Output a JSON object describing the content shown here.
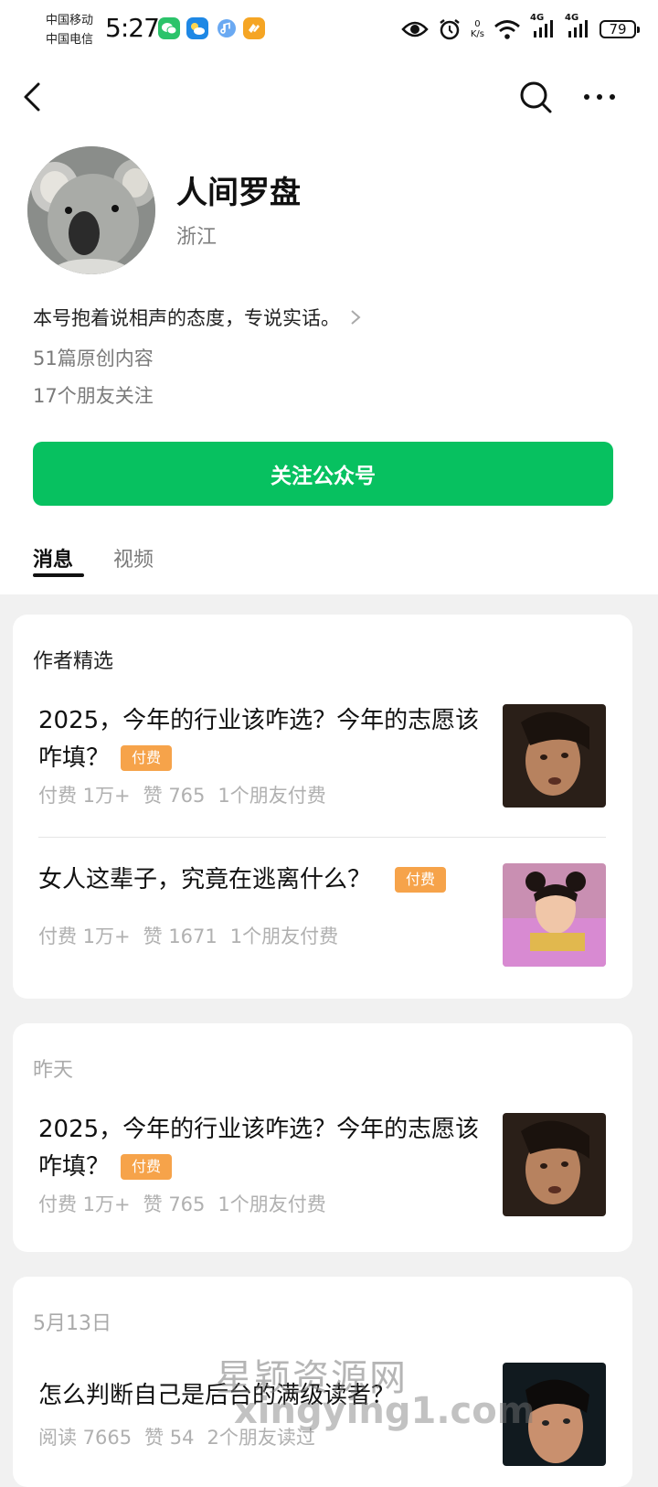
{
  "status_bar": {
    "carrier1": "中国移动",
    "carrier2": "中国电信",
    "time": "5:27",
    "net_speed_value": "0",
    "net_speed_unit": "K/s",
    "signal1": "4G",
    "signal2": "4G",
    "battery": "79"
  },
  "profile": {
    "name": "人间罗盘",
    "region": "浙江",
    "description": "本号抱着说相声的态度，专说实话。",
    "original_count": "51篇原创内容",
    "friends_following": "17个朋友关注",
    "follow_button": "关注公众号"
  },
  "tabs": [
    {
      "label": "消息",
      "active": true
    },
    {
      "label": "视频",
      "active": false
    }
  ],
  "featured": {
    "title": "作者精选",
    "articles": [
      {
        "title": "2025，今年的行业该咋选？今年的志愿该咋填？",
        "badge": "付费",
        "paid": "付费 1万+",
        "likes": "赞 765",
        "friends": "1个朋友付费"
      },
      {
        "title": "女人这辈子，究竟在逃离什么？",
        "badge": "付费",
        "paid": "付费 1万+",
        "likes": "赞 1671",
        "friends": "1个朋友付费"
      }
    ]
  },
  "yesterday": {
    "title": "昨天",
    "articles": [
      {
        "title": "2025，今年的行业该咋选？今年的志愿该咋填？",
        "badge": "付费",
        "paid": "付费 1万+",
        "likes": "赞 765",
        "friends": "1个朋友付费"
      }
    ]
  },
  "may13": {
    "title": "5月13日",
    "articles": [
      {
        "title": "怎么判断自己是后台的满级读者？",
        "reads": "阅读 7665",
        "likes": "赞 54",
        "friends": "2个朋友读过"
      }
    ]
  },
  "watermark": {
    "line1": "星颖资源网",
    "line2": "xingying1.com"
  },
  "colors": {
    "accent": "#07c160",
    "paid_badge": "#f6a34a",
    "meta_gray": "#b0b0b0"
  }
}
